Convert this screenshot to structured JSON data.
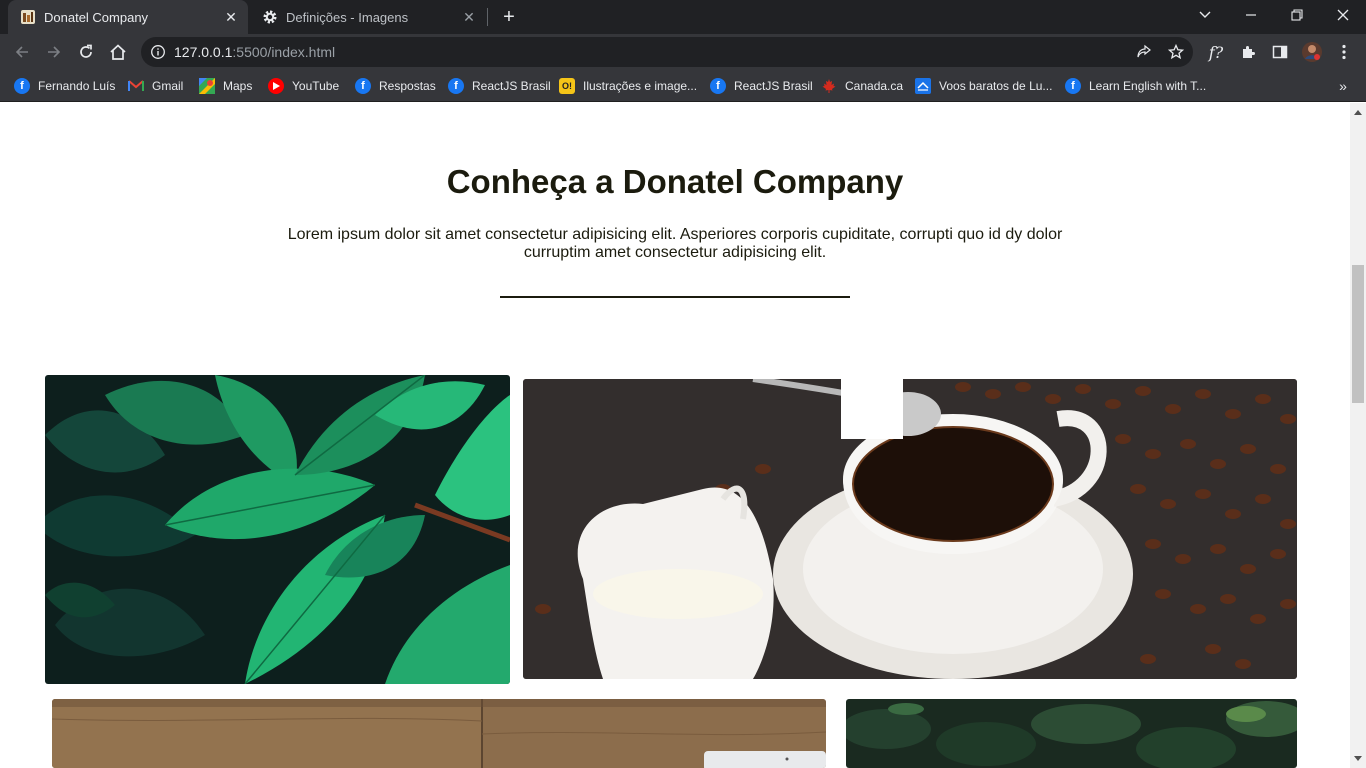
{
  "browser": {
    "tabs": [
      {
        "title": "Donatel Company",
        "active": true
      },
      {
        "title": "Definições - Imagens",
        "active": false
      }
    ],
    "url_host": "127.0.0.1",
    "url_path": ":5500/index.html",
    "bookmarks": [
      {
        "label": "Fernando Luís",
        "icon": "facebook-icon"
      },
      {
        "label": "Gmail",
        "icon": "gmail-icon"
      },
      {
        "label": "Maps",
        "icon": "maps-icon"
      },
      {
        "label": "YouTube",
        "icon": "youtube-icon"
      },
      {
        "label": "Respostas",
        "icon": "facebook-icon"
      },
      {
        "label": "ReactJS Brasil",
        "icon": "facebook-icon"
      },
      {
        "label": "Ilustrações e image...",
        "icon": "oi-icon"
      },
      {
        "label": "ReactJS Brasil",
        "icon": "facebook-icon"
      },
      {
        "label": "Canada.ca",
        "icon": "maple-leaf-icon"
      },
      {
        "label": "Voos baratos de Lu...",
        "icon": "flights-icon"
      },
      {
        "label": "Learn English with T...",
        "icon": "facebook-icon"
      }
    ]
  },
  "page": {
    "heading": "Conheça a Donatel Company",
    "lead": "Lorem ipsum dolor sit amet consectetur adipisicing elit. Asperiores corporis cupiditate, corrupti quo id dy dolor curruptim amet consectetur adipisicing elit.",
    "images": [
      {
        "subject": "green-leaves-photo"
      },
      {
        "subject": "coffee-cup-photo"
      },
      {
        "subject": "wooden-desk-photo"
      },
      {
        "subject": "dark-foliage-photo"
      }
    ]
  },
  "colors": {
    "chrome_dark": "#202124",
    "chrome_toolbar": "#35363a",
    "heading_text": "#1b1b0e",
    "facebook_blue": "#1877f2"
  }
}
